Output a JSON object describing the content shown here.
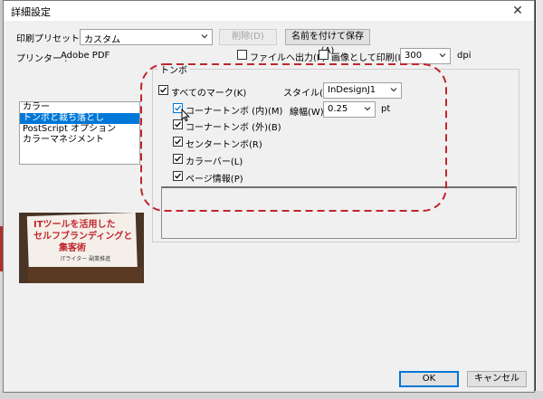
{
  "window": {
    "title": "詳細設定",
    "close_glyph": "✕"
  },
  "preset": {
    "label": "印刷プリセット(S) :",
    "value": "カスタム",
    "delete_label": "削除(D)",
    "save_as_label": "名前を付けて保存(A)"
  },
  "printer": {
    "label": "プリンター :",
    "name": "Adobe PDF"
  },
  "options": {
    "file_output_label": "ファイルへ出力(F)",
    "file_output_checked": false,
    "print_as_image_label": "画像として印刷(I)",
    "print_as_image_checked": false,
    "dpi_value": "300",
    "dpi_unit": "dpi"
  },
  "sidebar": {
    "items": [
      {
        "label": "カラー",
        "selected": false
      },
      {
        "label": "トンボと裁ち落とし",
        "selected": true
      },
      {
        "label": "PostScript オプション",
        "selected": false
      },
      {
        "label": "カラーマネジメント",
        "selected": false
      }
    ]
  },
  "thumbnail": {
    "line1": "ITツールを活用した",
    "line2": "セルフブランディングと",
    "line3": "集客術",
    "byline": "ITライター 副業推進"
  },
  "marks": {
    "group_title": "トンボ",
    "all_marks": {
      "label": "すべてのマーク(K)",
      "checked": true
    },
    "style_label": "スタイル(S) :",
    "style_value": "InDesignJ1",
    "weight_label": "線幅(W) :",
    "weight_value": "0.25",
    "weight_unit": "pt",
    "items": [
      {
        "label": "コーナートンボ (内)(M)",
        "checked": true
      },
      {
        "label": "コーナートンボ (外)(B)",
        "checked": true
      },
      {
        "label": "センタートンボ(R)",
        "checked": true
      },
      {
        "label": "カラーバー(L)",
        "checked": true
      },
      {
        "label": "ページ情報(P)",
        "checked": true
      }
    ]
  },
  "buttons": {
    "ok": "OK",
    "cancel": "キャンセル"
  },
  "colors": {
    "highlight": "#0078d7",
    "annotation": "#c0262c"
  }
}
